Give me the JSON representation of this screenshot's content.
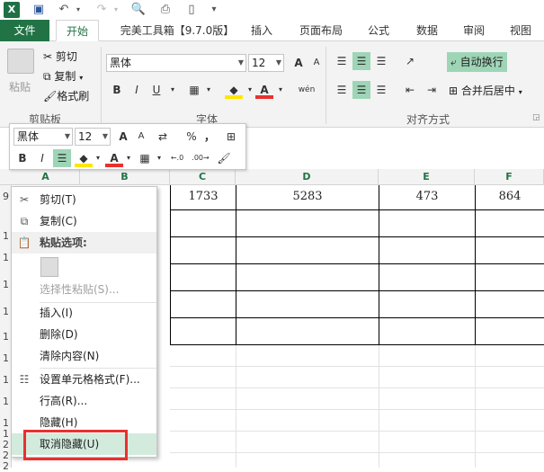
{
  "app": {
    "logo": "X"
  },
  "quick_access": {
    "icons": [
      "excel-logo",
      "save-icon",
      "undo-icon",
      "redo-icon",
      "print-preview-icon",
      "print-icon",
      "new-file-icon",
      "customize-icon"
    ]
  },
  "tabs": [
    {
      "label": "文件"
    },
    {
      "label": "开始"
    },
    {
      "label": "完美工具箱【9.7.0版】"
    },
    {
      "label": "插入"
    },
    {
      "label": "页面布局"
    },
    {
      "label": "公式"
    },
    {
      "label": "数据"
    },
    {
      "label": "审阅"
    },
    {
      "label": "视图"
    }
  ],
  "ribbon": {
    "clipboard": {
      "paste": "粘贴",
      "cut": "剪切",
      "copy": "复制",
      "format_painter": "格式刷",
      "label": "剪贴板"
    },
    "font": {
      "name": "黑体",
      "size": "12",
      "label": "字体",
      "bold": "B",
      "italic": "I",
      "underline": "U",
      "grow": "A",
      "shrink": "A",
      "phonetic": "wén",
      "font_color_letter": "A"
    },
    "align": {
      "wrap": "自动换行",
      "merge": "合并后居中",
      "label": "对齐方式"
    },
    "colors": {
      "accent": "#217346",
      "highlight": "#9fd5b7",
      "font_red": "#e8312f",
      "fill_yellow": "#ffe500"
    }
  },
  "mini_toolbar": {
    "font": "黑体",
    "size": "12",
    "percent": "%",
    "comma": "，",
    "bold": "B",
    "italic": "I",
    "dec_inc": "←.0 .00",
    "dec_dec": ".00 →.0"
  },
  "sheet": {
    "columns": [
      "A",
      "B",
      "C",
      "D",
      "E",
      "F"
    ],
    "rows": [
      "9",
      "1",
      "1",
      "1",
      "1",
      "1",
      "1",
      "1",
      "1",
      "1",
      "1",
      "2",
      "2",
      "2"
    ],
    "values": {
      "c": "1733",
      "d": "5283",
      "e": "473",
      "f": "864"
    }
  },
  "context_menu": {
    "cut": "剪切(T)",
    "copy": "复制(C)",
    "paste_options": "粘贴选项:",
    "paste_special": "选择性粘贴(S)...",
    "insert": "插入(I)",
    "delete": "删除(D)",
    "clear": "清除内容(N)",
    "format_cells": "设置单元格格式(F)...",
    "row_height": "行高(R)...",
    "hide": "隐藏(H)",
    "unhide": "取消隐藏(U)"
  }
}
